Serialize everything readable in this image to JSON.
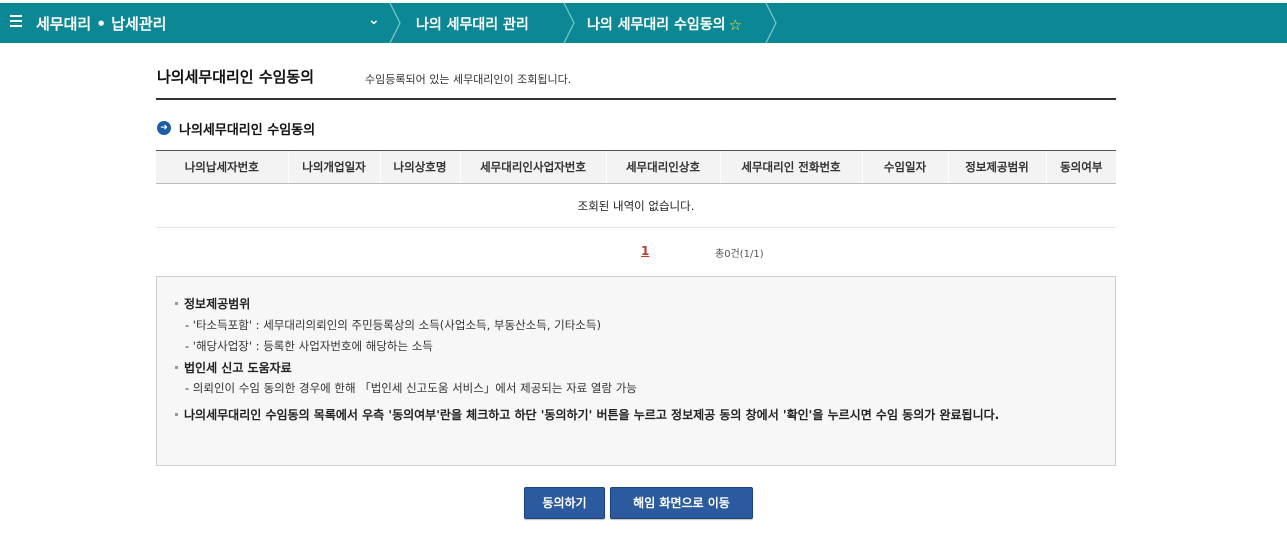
{
  "topbar": {
    "menu_icon": "hamburger-icon",
    "app_title": "세무대리 • 납세관리",
    "dropdown_icon": "chevron-down-icon",
    "breadcrumbs": [
      "나의 세무대리 관리",
      "나의 세무대리 수임동의"
    ],
    "favorite_icon": "star-outline-icon",
    "bg_color": "#0b8893"
  },
  "page": {
    "title": "나의세무대리인 수임동의",
    "description": "수임등록되어 있는 세무대리인이 조회됩니다."
  },
  "section": {
    "icon": "arrow-circle-right-icon",
    "title": "나의세무대리인 수임동의"
  },
  "table": {
    "headers": [
      "나의납세자번호",
      "나의개업일자",
      "나의상호명",
      "세무대리인사업자번호",
      "세무대리인상호",
      "세무대리인 전화번호",
      "수임일자",
      "정보제공범위",
      "동의여부"
    ],
    "empty_message": "조회된 내역이 없습니다."
  },
  "pagination": {
    "current_page": "1",
    "total": "총0건(1/1)"
  },
  "info": {
    "scope_heading": "정보제공범위",
    "scope_line1": "- '타소득포함' : 세무대리의뢰인의 주민등록상의 소득(사업소득, 부동산소득, 기타소득)",
    "scope_line2": "- '해당사업장' : 등록한 사업자번호에 해당하는 소득",
    "corp_heading": "법인세 신고 도움자료",
    "corp_line1": "- 의뢰인이 수임 동의한 경우에 한해 「법인세 신고도움 서비스」에서 제공되는 자료 열람 가능",
    "instruction": "나의세무대리인 수임동의 목록에서 우측 '동의여부'란을 체크하고 하단 '동의하기' 버튼을 누르고 정보제공 동의 창에서 '확인'을 누르시면 수임 동의가 완료됩니다."
  },
  "buttons": {
    "agree": "동의하기",
    "cancel": "해임 화면으로 이동",
    "color": "#2b5a9e"
  }
}
